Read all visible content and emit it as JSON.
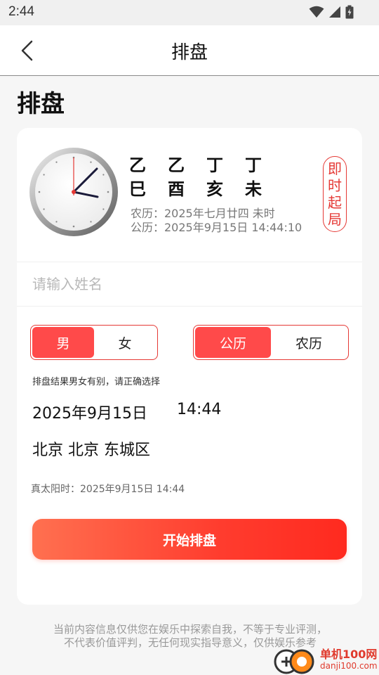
{
  "status_bar": {
    "time": "2:44",
    "icons": [
      "wifi-icon",
      "signal-icon",
      "battery-icon"
    ]
  },
  "nav": {
    "title": "排盘",
    "back_icon": "chevron-left-icon"
  },
  "page_heading": "排盘",
  "chart": {
    "pillars_stems": [
      "乙",
      "乙",
      "丁",
      "丁"
    ],
    "pillars_branches": [
      "巳",
      "酉",
      "亥",
      "未"
    ],
    "lunar_date": "农历：2025年七月廿四 未时",
    "solar_date": "公历：2025年9月15日 14:44:10",
    "instant_button_chars": [
      "即",
      "时",
      "起",
      "局"
    ]
  },
  "form": {
    "name_placeholder": "请输入姓名",
    "name_value": "",
    "gender": {
      "options": [
        "男",
        "女"
      ],
      "selected": "男"
    },
    "calendar": {
      "options": [
        "公历",
        "农历"
      ],
      "selected": "公历"
    },
    "gender_hint": "排盘结果男女有别，请正确选择",
    "date": "2025年9月15日",
    "time": "14:44",
    "location": "北京 北京 东城区",
    "true_solar_time": "真太阳时：2025年9月15日  14:44",
    "submit_label": "开始排盘"
  },
  "disclaimer": "当前内容信息仅供您在娱乐中探索自我，不等于专业评测，不代表价值评判，无任何现实指导意义，仅供娱乐参考",
  "watermark": {
    "cn": "单机100网",
    "en": "danji100.com"
  },
  "colors": {
    "accent": "#e53935",
    "button_start": "#ff7050",
    "button_end": "#ff2a1f",
    "segment_active": "#ff4a4a"
  }
}
